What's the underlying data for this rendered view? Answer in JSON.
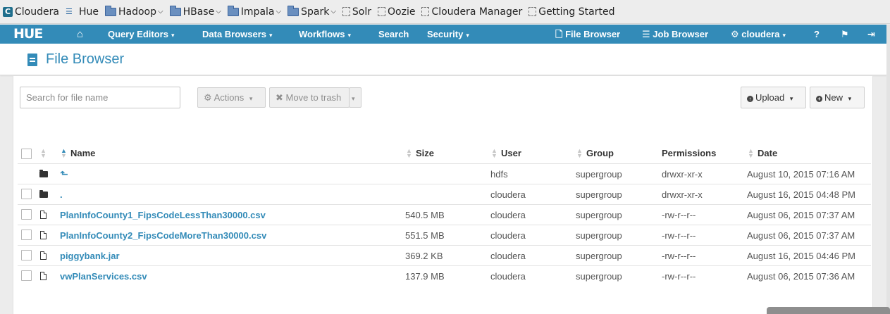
{
  "bookmarks": [
    {
      "label": "Cloudera",
      "icon": "cloudera-icon",
      "dropdown": false
    },
    {
      "label": "Hue",
      "icon": "hue-icon",
      "dropdown": false
    },
    {
      "label": "Hadoop",
      "icon": "folder-icon",
      "dropdown": true
    },
    {
      "label": "HBase",
      "icon": "folder-icon",
      "dropdown": true
    },
    {
      "label": "Impala",
      "icon": "folder-icon",
      "dropdown": true
    },
    {
      "label": "Spark",
      "icon": "folder-icon",
      "dropdown": true
    },
    {
      "label": "Solr",
      "icon": "page-icon",
      "dropdown": false
    },
    {
      "label": "Oozie",
      "icon": "page-icon",
      "dropdown": false
    },
    {
      "label": "Cloudera Manager",
      "icon": "page-icon",
      "dropdown": false
    },
    {
      "label": "Getting Started",
      "icon": "page-icon",
      "dropdown": false
    }
  ],
  "navbar": {
    "logo": "HUE",
    "query_editors": "Query Editors",
    "data_browsers": "Data Browsers",
    "workflows": "Workflows",
    "search": "Search",
    "security": "Security",
    "file_browser": "File Browser",
    "job_browser": "Job Browser",
    "user": "cloudera",
    "accent_color": "#338bb8"
  },
  "page": {
    "title": "File Browser"
  },
  "toolbar": {
    "search_placeholder": "Search for file name",
    "actions": "Actions",
    "move_to_trash": "Move to trash",
    "upload": "Upload",
    "new": "New"
  },
  "table": {
    "columns": {
      "name": "Name",
      "size": "Size",
      "user": "User",
      "group": "Group",
      "permissions": "Permissions",
      "date": "Date"
    },
    "rows": [
      {
        "type": "folder",
        "name": "⬑",
        "size": "",
        "user": "hdfs",
        "group": "supergroup",
        "permissions": "drwxr-xr-x",
        "date": "August 10, 2015 07:16 AM",
        "checkbox": false
      },
      {
        "type": "folder",
        "name": ".",
        "size": "",
        "user": "cloudera",
        "group": "supergroup",
        "permissions": "drwxr-xr-x",
        "date": "August 16, 2015 04:48 PM",
        "checkbox": true
      },
      {
        "type": "file",
        "name": "PlanInfoCounty1_FipsCodeLessThan30000.csv",
        "size": "540.5 MB",
        "user": "cloudera",
        "group": "supergroup",
        "permissions": "-rw-r--r--",
        "date": "August 06, 2015 07:37 AM",
        "checkbox": true
      },
      {
        "type": "file",
        "name": "PlanInfoCounty2_FipsCodeMoreThan30000.csv",
        "size": "551.5 MB",
        "user": "cloudera",
        "group": "supergroup",
        "permissions": "-rw-r--r--",
        "date": "August 06, 2015 07:37 AM",
        "checkbox": true
      },
      {
        "type": "file",
        "name": "piggybank.jar",
        "size": "369.2 KB",
        "user": "cloudera",
        "group": "supergroup",
        "permissions": "-rw-r--r--",
        "date": "August 16, 2015 04:46 PM",
        "checkbox": true
      },
      {
        "type": "file",
        "name": "vwPlanServices.csv",
        "size": "137.9 MB",
        "user": "cloudera",
        "group": "supergroup",
        "permissions": "-rw-r--r--",
        "date": "August 06, 2015 07:36 AM",
        "checkbox": true
      }
    ]
  }
}
